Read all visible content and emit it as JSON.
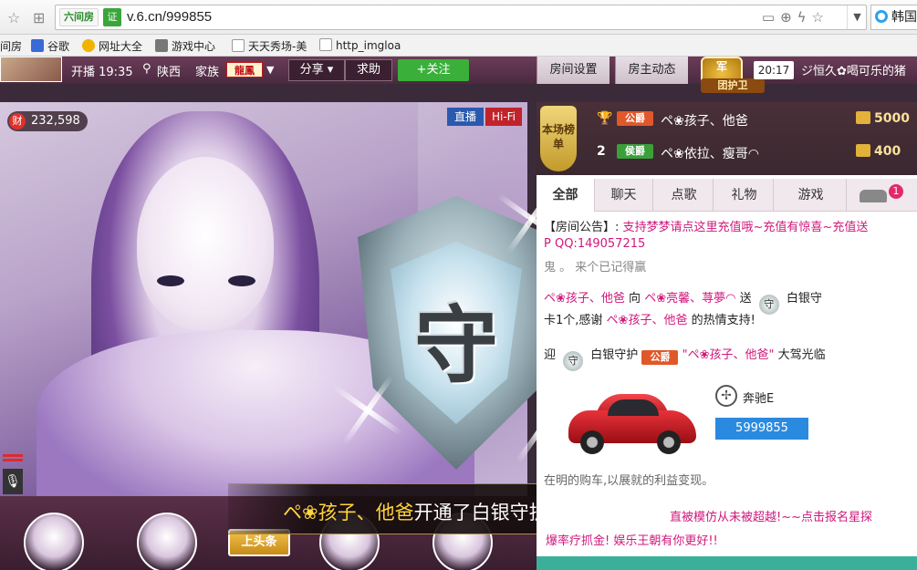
{
  "browser": {
    "site_badge": "六间房",
    "cert": "证",
    "url": "v.6.cn/999855",
    "search_text": "韩国"
  },
  "bookmarks": [
    {
      "label": "间房"
    },
    {
      "label": "谷歌"
    },
    {
      "label": "网址大全"
    },
    {
      "label": "游戏中心"
    },
    {
      "label": "天天秀场-美"
    },
    {
      "label": "http_imgloa"
    }
  ],
  "roombar": {
    "live_time": "开播 19:35",
    "location": "陕西",
    "family_label": "家族",
    "family_badge": "龍鳳",
    "share": "分享",
    "help": "求助",
    "follow": "+关注",
    "room_settings": "房间设置",
    "host_updates": "房主动态",
    "guard_emblem": "军",
    "guard_label": "团护卫",
    "clock": "20:17",
    "marquee": "ジ恒久✿喝可乐的猪"
  },
  "video": {
    "coin_icon": "财",
    "coin_count": "232,598",
    "live_tag": "直播",
    "hifi_tag": "Hi-Fi",
    "shield_char": "守",
    "notice_user": "ペ❀孩子、他爸",
    "notice_rest": "开通了白银守护!"
  },
  "bottom": {
    "topline_sign": "上头条"
  },
  "rank": {
    "emblem": "本场榜单",
    "rows": [
      {
        "no": "",
        "level": "公爵",
        "level_color": "#e0582a",
        "name": "ペ❀孩子、他爸",
        "amount": "5000"
      },
      {
        "no": "2",
        "level": "侯爵",
        "level_color": "#3aa03a",
        "name": "ペ❀依拉、瘦哥◠",
        "amount": "400"
      }
    ]
  },
  "tabs": {
    "all": "全部",
    "chat": "聊天",
    "songs": "点歌",
    "gifts": "礼物",
    "games": "游戏",
    "car_badge": "1"
  },
  "messages": {
    "announce_label": "【房间公告】:",
    "announce_text": "支持梦梦请点这里充值哦~充值有惊喜~充值送",
    "announce_line2": "P QQ:149057215",
    "line3": "鬼 。 来个已记得赢",
    "gift_user": "ペ❀孩子、他爸",
    "gift_to_word": "向",
    "gift_target": "ペ❀亮馨、荨夢◠",
    "gift_send_word": "送",
    "gift_item": "白银守",
    "gift_line2_a": "卡1个,感谢",
    "gift_line2_user": "ペ❀孩子、他爸",
    "gift_line2_b": "的热情支持!",
    "welcome_a": "迎",
    "welcome_guard": "白银守护",
    "welcome_level": "公爵",
    "welcome_user": "\"ペ❀孩子、他爸\"",
    "welcome_b": "大驾光临",
    "benz_name": "奔驰E",
    "car_number": "5999855",
    "cutoff": "在明的购车,以展就的利益变现。"
  },
  "ticker": {
    "line1": "直被模仿从未被超越!~~点击报名星探",
    "line2": "爆率疗抓金! 娱乐王朝有你更好!!"
  }
}
